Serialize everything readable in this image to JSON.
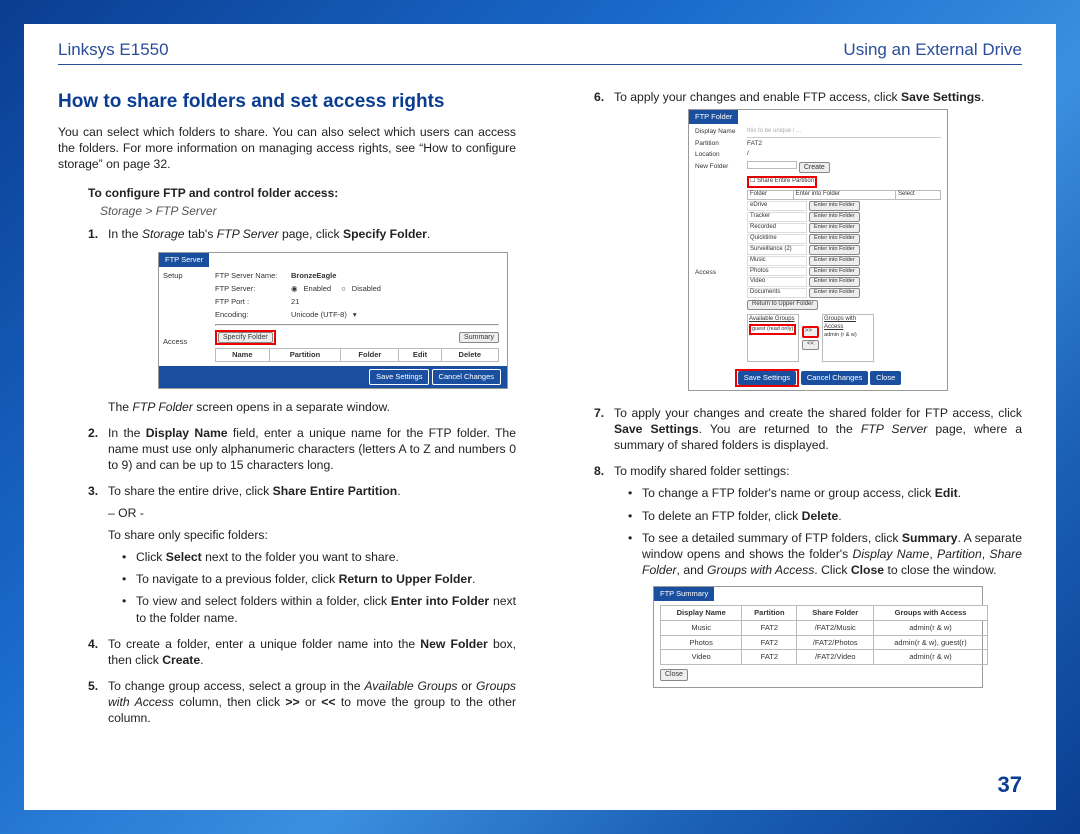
{
  "header": {
    "left": "Linksys E1550",
    "right": "Using an External Drive"
  },
  "page_number": "37",
  "left": {
    "h2": "How to share folders and set access rights",
    "intro": "You can select which folders to share. You can also select which users can access the folders. For more information on managing access rights, see “How to configure storage” on page 32.",
    "subhead": "To configure FTP and control folder access:",
    "breadcrumb": "Storage > FTP Server",
    "s1_text_pre": "In the ",
    "s1_text_mid": "Storage",
    "s1_text_mid2": " tab's ",
    "s1_text_mid3": "FTP Server",
    "s1_text_end": " page, click ",
    "s1_bold": "Specify Folder",
    "s1_after": ".",
    "shot1_caption_pre": "The ",
    "shot1_caption_it": "FTP Folder",
    "shot1_caption_end": " screen opens in a separate window.",
    "s2_pre": "In the ",
    "s2_b1": "Display Name",
    "s2_mid": " field, enter a unique name for the FTP folder. The name must use only alphanumeric characters (letters A to Z and numbers 0 to 9) and can be up to 15 characters long.",
    "s3_pre": "To share the entire drive, click ",
    "s3_b": "Share Entire Partition",
    "s3_end": ".",
    "or": "– OR -",
    "s3b": "To share only specific folders:",
    "b1_pre": "Click ",
    "b1_b": "Select",
    "b1_end": " next to the folder you want to share.",
    "b2_pre": "To navigate to a previous folder, click ",
    "b2_b": "Return to Upper Folder",
    "b2_end": ".",
    "b3_pre": "To view and select folders within a folder, click ",
    "b3_b": "Enter into Folder",
    "b3_end": " next to the folder name.",
    "s4_pre": "To create a folder, enter a unique folder name into the ",
    "s4_b": "New Folder",
    "s4_mid": " box, then click ",
    "s4_b2": "Create",
    "s4_end": ".",
    "s5_pre": "To change group access, select a group in the ",
    "s5_i1": "Available Groups",
    "s5_mid1": " or ",
    "s5_i2": "Groups with Access",
    "s5_mid2": " column, then click ",
    "s5_b1": ">>",
    "s5_mid3": " or ",
    "s5_b2": "<<",
    "s5_end": " to move the group to the other column.",
    "shot1": {
      "tab": "FTP Server",
      "side1": "Setup",
      "side2": "Access",
      "r1l": "FTP Server Name:",
      "r1v": "BronzeEagle",
      "r2l": "FTP Server:",
      "r2a": "Enabled",
      "r2b": "Disabled",
      "r3l": "FTP Port :",
      "r3v": "21",
      "r4l": "Encoding:",
      "r4v": "Unicode (UTF-8)",
      "specify": "Specify Folder",
      "summary": "Summary",
      "th1": "Name",
      "th2": "Partition",
      "th3": "Folder",
      "th4": "Edit",
      "th5": "Delete",
      "save": "Save Settings",
      "cancel": "Cancel Changes"
    }
  },
  "right": {
    "s6_pre": "To apply your changes and enable FTP access, click ",
    "s6_b": "Save Settings",
    "s6_end": ".",
    "s7_pre": "To apply your changes and create the shared folder for FTP access, click ",
    "s7_b": "Save Settings",
    "s7_mid": ". You are returned to the ",
    "s7_it": "FTP Server",
    "s7_end": " page, where a summary of shared folders is displayed.",
    "s8": "To modify shared folder settings:",
    "b1_pre": "To change a FTP folder's name or group access, click ",
    "b1_b": "Edit",
    "b1_end": ".",
    "b2_pre": "To delete an FTP folder, click ",
    "b2_b": "Delete",
    "b2_end": ".",
    "b3_pre": "To see a detailed summary of FTP folders, click ",
    "b3_b": "Summary",
    "b3_mid": ". A separate window opens and shows the folder's ",
    "b3_i1": "Display Name",
    "b3_c1": ", ",
    "b3_i2": "Partition",
    "b3_c2": ", ",
    "b3_i3": "Share Folder",
    "b3_c3": ", and ",
    "b3_i4": "Groups with Access",
    "b3_mid2": ". Click ",
    "b3_b2": "Close",
    "b3_end": " to close the window.",
    "shot2": {
      "tab": "FTP Folder",
      "dn": "Display Name",
      "part": "Partition",
      "partv": "FAT2",
      "loc": "Location",
      "locv": "/",
      "nf": "New Folder",
      "create": "Create",
      "share": "Share Entire Partition",
      "thf": "Folder",
      "the": "Enter into Folder",
      "ths": "Select",
      "rows": [
        "eDrive",
        "Tracker",
        "Recorded",
        "Quicktime",
        "Surveillance (2)",
        "Music",
        "Photos",
        "Video",
        "Documents"
      ],
      "enter": "Enter into Folder",
      "return_upper": "Return to Upper Folder",
      "access": "Access",
      "ag": "Available Groups",
      "gw": "Groups with Access",
      "g1": "guest (read only)",
      "g2": "admin (r & w)",
      "rr": ">>",
      "ll": "<<",
      "save": "Save Settings",
      "cancel": "Cancel Changes",
      "close": "Close"
    },
    "shot3": {
      "tab": "FTP Summary",
      "th1": "Display Name",
      "th2": "Partition",
      "th3": "Share Folder",
      "th4": "Groups with Access",
      "rows": [
        {
          "dn": "Music",
          "p": "FAT2",
          "sf": "/FAT2/Music",
          "g": "admin(r & w)"
        },
        {
          "dn": "Photos",
          "p": "FAT2",
          "sf": "/FAT2/Photos",
          "g": "admin(r & w), guest(r)"
        },
        {
          "dn": "Video",
          "p": "FAT2",
          "sf": "/FAT2/Video",
          "g": "admin(r & w)"
        }
      ],
      "close": "Close"
    }
  }
}
